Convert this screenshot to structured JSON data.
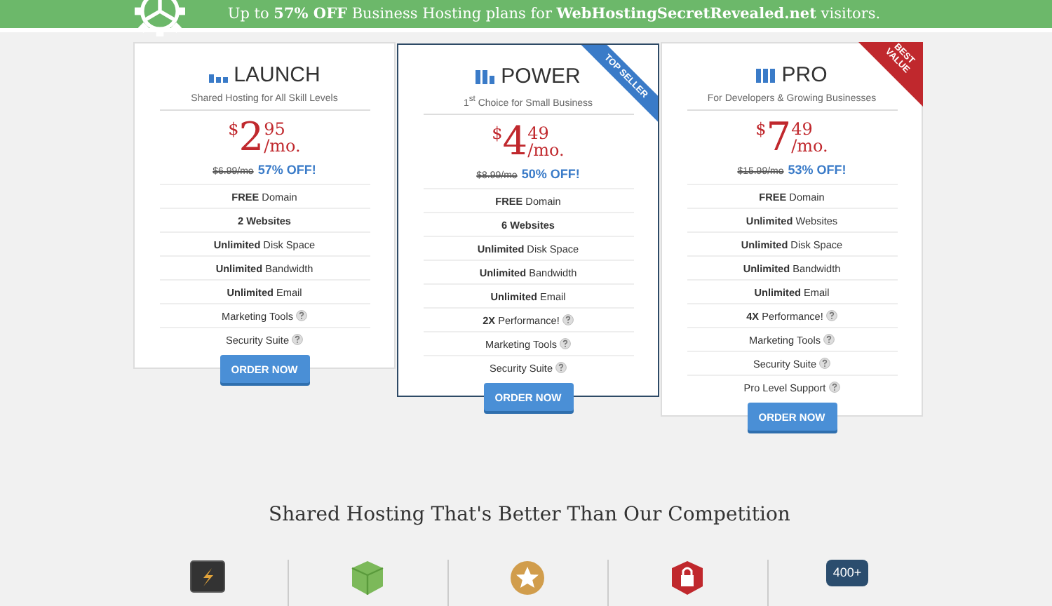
{
  "banner": {
    "text": "Up to **57% OFF** Business Hosting plans for **WebHostingSecretRevealed.net** visitors."
  },
  "plans": [
    {
      "name": "LAUNCH",
      "tagline": "Shared Hosting for All Skill Levels",
      "currency": "$",
      "price_whole": "2",
      "price_cents": "95",
      "period": "/mo.",
      "old_price": "$6.99/mo",
      "discount": "57% OFF!",
      "featured": false,
      "button": "ORDER NOW",
      "features": [
        {
          "text": "**FREE** Domain",
          "help": false
        },
        {
          "text": "**2 Websites**",
          "help": false
        },
        {
          "text": "**Unlimited** Disk Space",
          "help": false
        },
        {
          "text": "**Unlimited** Bandwidth",
          "help": false
        },
        {
          "text": "**Unlimited** Email",
          "help": false
        },
        {
          "text": "Marketing Tools",
          "help": true
        },
        {
          "text": "Security Suite",
          "help": true
        }
      ]
    },
    {
      "name": "POWER",
      "tagline": "1$^{st}$ Choice for Small Business",
      "currency": "$",
      "price_whole": "4",
      "price_cents": "49",
      "period": "/mo.",
      "old_price": "$8.99/mo",
      "discount": "50% OFF!",
      "featured": true,
      "ribbon": {
        "kind": "band",
        "text": "TOP SELLER"
      },
      "button": "ORDER NOW",
      "features": [
        {
          "text": "**FREE** Domain",
          "help": false
        },
        {
          "text": "**6 Websites**",
          "help": false
        },
        {
          "text": "**Unlimited** Disk Space",
          "help": false
        },
        {
          "text": "**Unlimited** Bandwidth",
          "help": false
        },
        {
          "text": "**Unlimited** Email",
          "help": false
        },
        {
          "text": "**2X** Performance!",
          "help": true
        },
        {
          "text": "Marketing Tools",
          "help": true
        },
        {
          "text": "Security Suite",
          "help": true
        }
      ]
    },
    {
      "name": "PRO",
      "tagline": "For Developers & Growing Businesses",
      "currency": "$",
      "price_whole": "7",
      "price_cents": "49",
      "period": "/mo.",
      "old_price": "$15.99/mo",
      "discount": "53% OFF!",
      "featured": false,
      "ribbon": {
        "kind": "corner",
        "text": "BEST VALUE"
      },
      "button": "ORDER NOW",
      "features": [
        {
          "text": "**FREE** Domain",
          "help": false
        },
        {
          "text": "**Unlimited** Websites",
          "help": false
        },
        {
          "text": "**Unlimited** Disk Space",
          "help": false
        },
        {
          "text": "**Unlimited** Bandwidth",
          "help": false
        },
        {
          "text": "**Unlimited** Email",
          "help": false
        },
        {
          "text": "**4X** Performance!",
          "help": true
        },
        {
          "text": "Marketing Tools",
          "help": true
        },
        {
          "text": "Security Suite",
          "help": true
        },
        {
          "text": "Pro Level Support",
          "help": true
        }
      ]
    }
  ],
  "comparison": {
    "title": "Shared Hosting That's Better Than Our Competition",
    "perks": [
      {
        "kind": "ssd"
      },
      {
        "kind": "box"
      },
      {
        "kind": "badge"
      },
      {
        "kind": "lock"
      },
      {
        "kind": "count",
        "label": "400+"
      }
    ]
  }
}
